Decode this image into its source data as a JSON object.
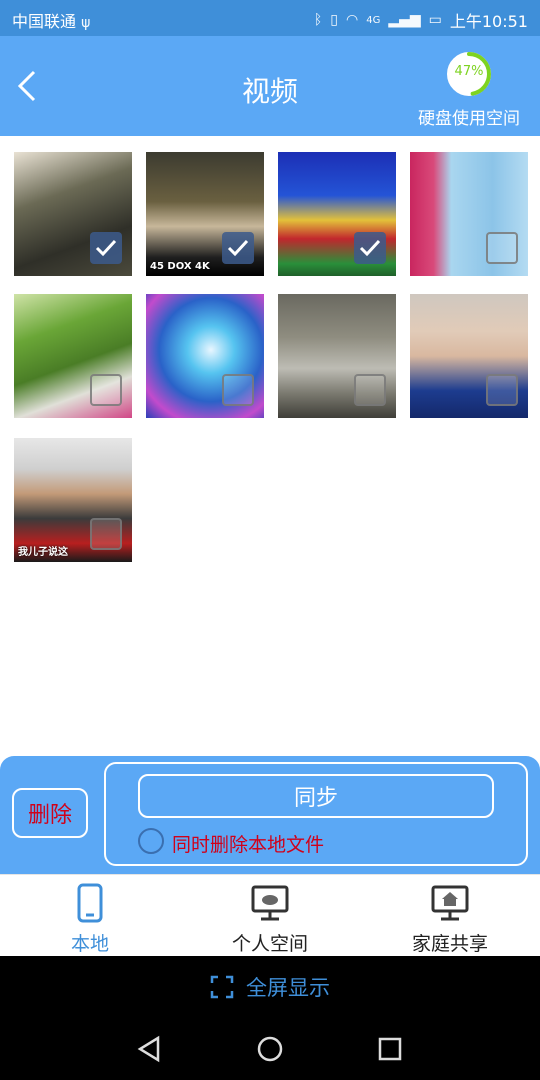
{
  "status": {
    "carrier": "中国联通",
    "time": "上午10:51",
    "net": "4G"
  },
  "header": {
    "title": "视频",
    "disk_percent": "47%",
    "disk_fraction": 0.47,
    "disk_caption": "硬盘使用空间"
  },
  "thumbnails": [
    {
      "checked": true,
      "caption": ""
    },
    {
      "checked": true,
      "caption": "45   DOX 4K"
    },
    {
      "checked": true,
      "caption": ""
    },
    {
      "checked": false,
      "caption": ""
    },
    {
      "checked": false,
      "caption": ""
    },
    {
      "checked": false,
      "caption": ""
    },
    {
      "checked": false,
      "caption": ""
    },
    {
      "checked": false,
      "caption": ""
    },
    {
      "checked": false,
      "caption": "我儿子说这"
    }
  ],
  "panel": {
    "delete_label": "删除",
    "sync_label": "同步",
    "delete_local_label": "同时删除本地文件"
  },
  "tabs": [
    {
      "label": "本地"
    },
    {
      "label": "个人空间"
    },
    {
      "label": "家庭共享"
    }
  ],
  "fullscreen_label": "全屏显示",
  "colors": {
    "header": "#5ba8f5",
    "accent": "#3f8fd9",
    "warning_text": "#d0021b",
    "disk_ring": "#7ed321"
  }
}
